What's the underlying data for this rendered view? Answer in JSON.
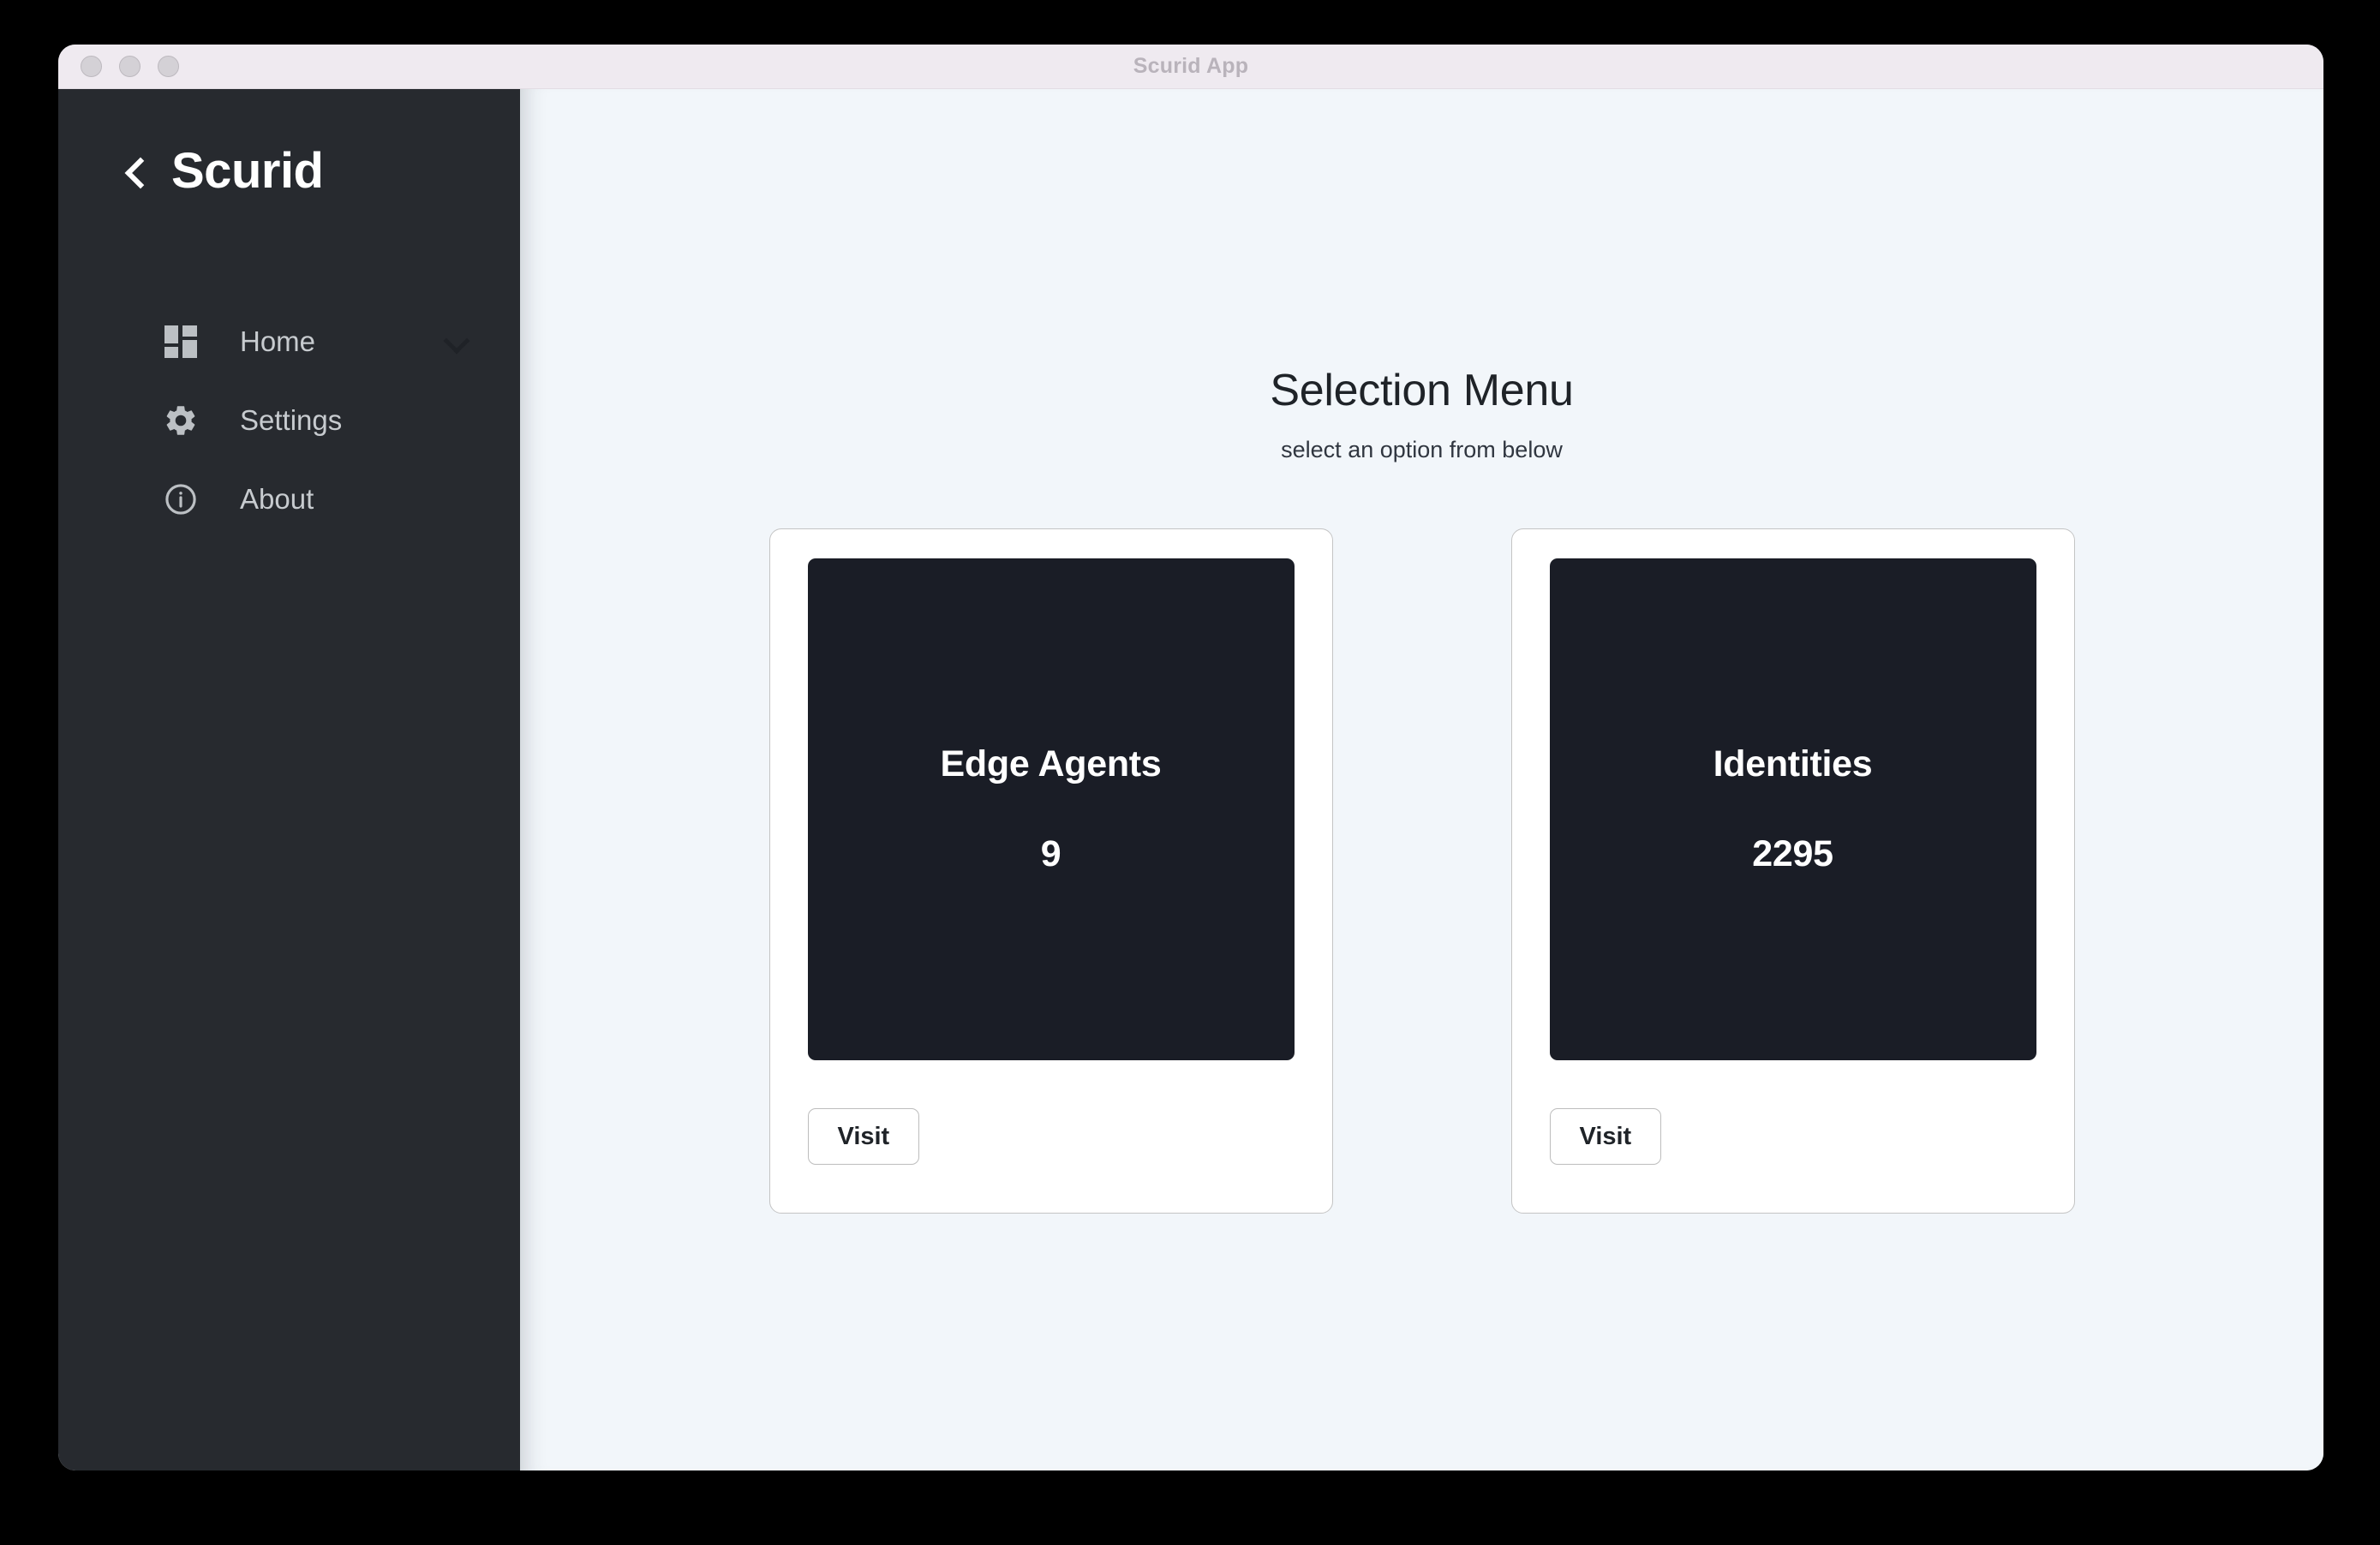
{
  "window": {
    "title": "Scurid App",
    "traffic_lights": [
      "close-button",
      "minimize-button",
      "zoom-button"
    ]
  },
  "sidebar": {
    "back_icon": "chevron-left-icon",
    "brand": "Scurid",
    "items": [
      {
        "label": "Home",
        "icon": "grid-icon",
        "expandable": true,
        "chevron": "chevron-down-icon"
      },
      {
        "label": "Settings",
        "icon": "gear-icon",
        "expandable": false
      },
      {
        "label": "About",
        "icon": "info-circle-icon",
        "expandable": false
      }
    ]
  },
  "main": {
    "title": "Selection Menu",
    "subtitle": "select an option from below",
    "cards": [
      {
        "title": "Edge Agents",
        "value": "9",
        "button_label": "Visit"
      },
      {
        "title": "Identities",
        "value": "2295",
        "button_label": "Visit"
      }
    ]
  },
  "colors": {
    "sidebar_bg": "#272a2f",
    "content_bg": "#f2f6fa",
    "panel_bg": "#1a1d26",
    "titlebar_bg": "#efeaf0",
    "card_border": "#c4c4c4",
    "nav_label": "#c7cbcf"
  }
}
